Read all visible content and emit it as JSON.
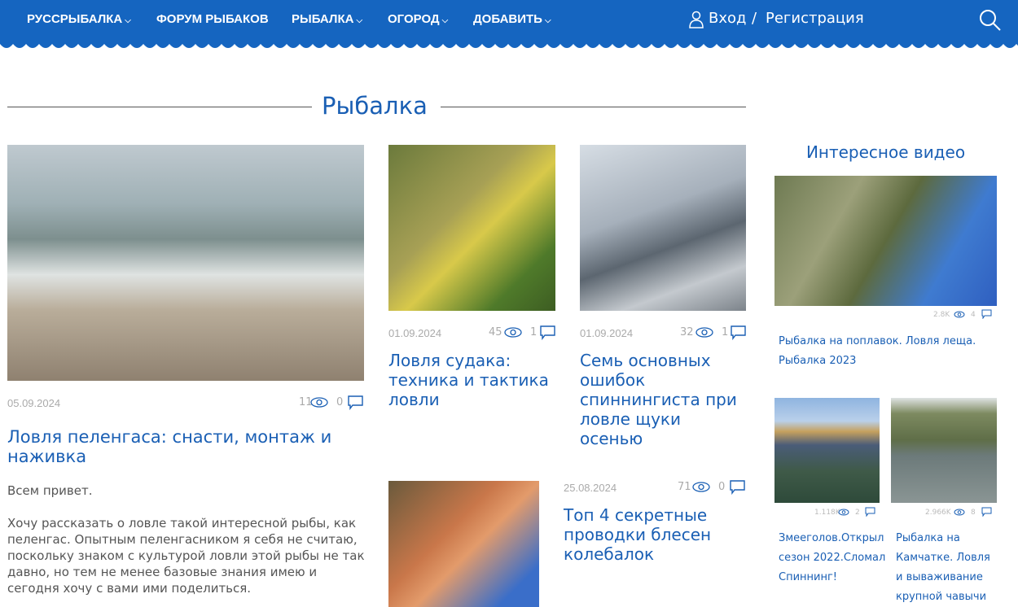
{
  "nav": {
    "items": [
      "РУССРЫБАЛКА",
      "ФОРУМ РЫБАКОВ",
      "РЫБАЛКА",
      "ОГОРОД",
      "ДОБАВИТЬ"
    ],
    "login": "Вход",
    "sep": "/",
    "register": "Регистрация"
  },
  "section_title": "Рыбалка",
  "articles": [
    {
      "date": "05.09.2024",
      "views": "11",
      "comments": "0",
      "title": "Ловля пеленгаса: снасти, монтаж и наживка",
      "excerpt1": "Всем привет.",
      "excerpt2": "Хочу рассказать о ловле такой интересной рыбы, как пеленгас. Опытным пеленгасником я себя не считаю, поскольку знаком с культурой ловли этой рыбы не так давно, но тем не менее базовые знания имею и сегодня хочу с вами ими поделиться."
    },
    {
      "date": "01.09.2024",
      "views": "45",
      "comments": "1",
      "title": "Ловля судака: техника и тактика ловли"
    },
    {
      "date": "01.09.2024",
      "views": "32",
      "comments": "1",
      "title": "Семь основных ошибок спиннингиста при ловле щуки осенью"
    },
    {
      "date": "25.08.2024",
      "views": "71",
      "comments": "0",
      "title": "Топ 4 секретные проводки блесен колебалок"
    }
  ],
  "sidebar": {
    "title": "Интересное видео",
    "videos": [
      {
        "views": "2.8K",
        "comments": "4",
        "title": "Рыбалка на поплавок. Ловля леща. Рыбалка 2023"
      },
      {
        "views": "1.118K",
        "comments": "2",
        "title": "Змееголов.Открыл сезон 2022.Сломал Спиннинг!"
      },
      {
        "views": "2.966K",
        "comments": "8",
        "title": "Рыбалка на Камчатке. Ловля и вываживание крупной чавычи"
      }
    ]
  },
  "colors": {
    "header": "#1565c0",
    "accent": "#1a5fb4"
  }
}
